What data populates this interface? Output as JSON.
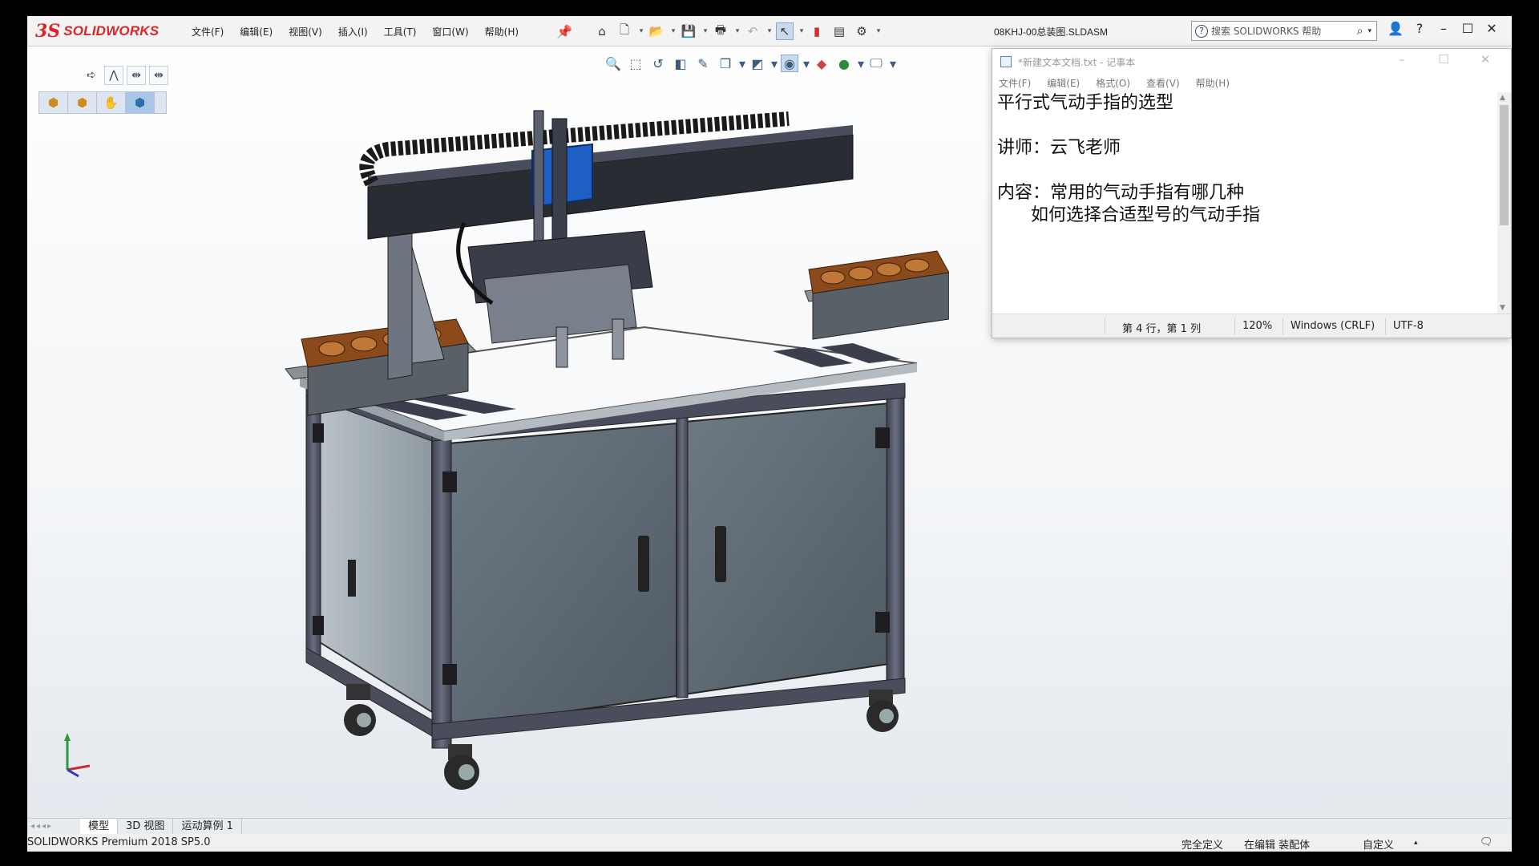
{
  "app": {
    "logo_prefix": "3S",
    "logo_text": "SOLIDWORKS",
    "document_title": "08KHJ-00总装图.SLDASM"
  },
  "menu": [
    "文件(F)",
    "编辑(E)",
    "视图(V)",
    "插入(I)",
    "工具(T)",
    "窗口(W)",
    "帮助(H)"
  ],
  "search": {
    "placeholder": "搜索 SOLIDWORKS 帮助"
  },
  "window_controls": {
    "minimize": "–",
    "maximize": "☐",
    "close": "✕",
    "help": "?"
  },
  "notepad": {
    "title": "*新建文本文档.txt - 记事本",
    "menu": [
      "文件(F)",
      "编辑(E)",
      "格式(O)",
      "查看(V)",
      "帮助(H)"
    ],
    "lines": [
      "平行式气动手指的选型",
      "",
      "讲师：云飞老师",
      "",
      "内容：常用的气动手指有哪几种",
      "      如何选择合适型号的气动手指"
    ],
    "status": {
      "position": "第 4 行，第 1 列",
      "zoom": "120%",
      "line_ending": "Windows (CRLF)",
      "encoding": "UTF-8"
    }
  },
  "bottom_tabs": [
    "模型",
    "3D 视图",
    "运动算例 1"
  ],
  "status_bar": {
    "version": "SOLIDWORKS Premium 2018 SP5.0",
    "definition": "完全定义",
    "editing": "在编辑 装配体",
    "custom": "自定义"
  },
  "colors": {
    "brand_red": "#d8262b",
    "cabinet_panel": "#5f6b74",
    "frame": "#4a4e5c",
    "gripper_blue": "#1e5fc4",
    "tray_brown": "#8a4a1c"
  }
}
